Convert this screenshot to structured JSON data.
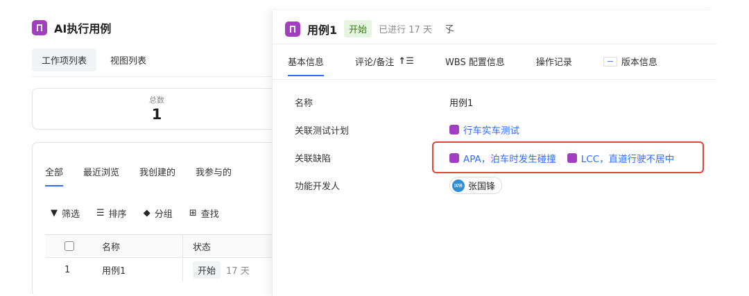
{
  "left": {
    "app_title": "AI执行用例",
    "view_tabs": [
      "工作项列表",
      "视图列表"
    ],
    "total_label": "总数",
    "total_value": "1",
    "filter_tabs": [
      "全部",
      "最近浏览",
      "我创建的",
      "我参与的"
    ],
    "tools": [
      {
        "label": "筛选",
        "icon": "filter-icon"
      },
      {
        "label": "排序",
        "icon": "sort-icon"
      },
      {
        "label": "分组",
        "icon": "tag-icon"
      },
      {
        "label": "查找",
        "icon": "find-icon"
      }
    ],
    "table": {
      "headers": [
        "名称",
        "状态"
      ],
      "rows": [
        {
          "index": "1",
          "name": "用例1",
          "state": "开始",
          "days": "17 天"
        }
      ]
    }
  },
  "detail": {
    "title": "用例1",
    "status": "开始",
    "elapsed": "已进行 17 天",
    "pin_glyph": "孓",
    "tabs": [
      "基本信息",
      "评论/备注",
      "WBS 配置信息",
      "操作记录",
      "版本信息"
    ],
    "fields": {
      "name_label": "名称",
      "name_value": "用例1",
      "plan_label": "关联测试计划",
      "plan_value": "行车实车测试",
      "defect_label": "关联缺陷",
      "defects": [
        "APA，泊车时发生碰撞",
        "LCC，直道行驶不居中"
      ],
      "dev_label": "功能开发人",
      "dev_avatar": "国锋",
      "dev_value": "张国锋"
    }
  },
  "colors": {
    "accent": "#2f6bff",
    "purple": "#a23fc0",
    "highlight": "#e0433b",
    "status_green_bg": "#e6f5df"
  }
}
